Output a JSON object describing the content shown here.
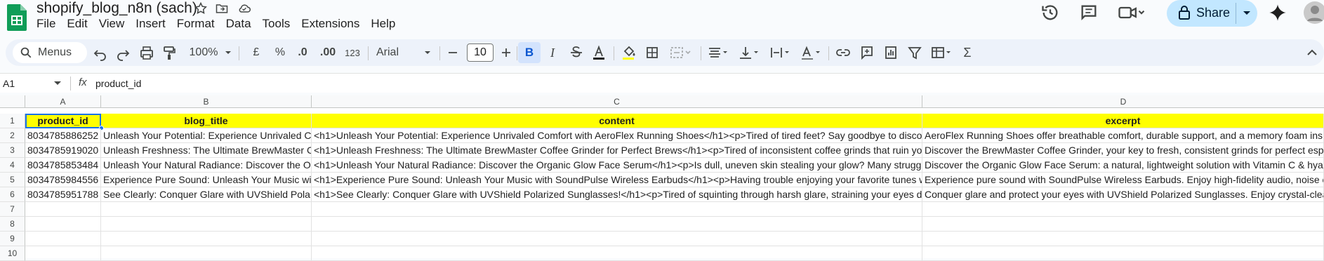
{
  "app": {
    "doc_title": "shopify_blog_n8n (sach)",
    "menu": [
      "File",
      "Edit",
      "View",
      "Insert",
      "Format",
      "Data",
      "Tools",
      "Extensions",
      "Help"
    ],
    "share_label": "Share"
  },
  "toolbar": {
    "menus_label": "Menus",
    "zoom": "100%",
    "currency": "£",
    "percent": "%",
    "dec_decrease": ".0",
    "dec_increase": ".00",
    "number_format": "123",
    "font": "Arial",
    "font_size": "10"
  },
  "formula_bar": {
    "cell_ref": "A1",
    "fx": "fx",
    "value": "product_id"
  },
  "sheet": {
    "columns": [
      "A",
      "B",
      "C",
      "D"
    ],
    "rows": [
      "1",
      "2",
      "3",
      "4",
      "5",
      "6",
      "7",
      "8",
      "9",
      "10"
    ],
    "header": [
      "product_id",
      "blog_title",
      "content",
      "excerpt"
    ],
    "data": [
      [
        "8034785886252",
        "Unleash Your Potential: Experience Unrivaled C",
        "<h1>Unleash Your Potential: Experience Unrivaled Comfort with AeroFlex Running Shoes</h1><p>Tired of tired feet? Say goodbye to disco",
        "AeroFlex Running Shoes offer breathable comfort, durable support, and a memory foam ins"
      ],
      [
        "8034785919020",
        "Unleash Freshness: The Ultimate BrewMaster C",
        "<h1>Unleash Freshness: The Ultimate BrewMaster Coffee Grinder for Perfect Brews</h1><p>Tired of inconsistent coffee grinds that ruin you",
        "Discover the BrewMaster Coffee Grinder, your key to fresh, consistent grinds for perfect esp"
      ],
      [
        "8034785853484",
        "Unleash Your Natural Radiance: Discover the O",
        "<h1>Unleash Your Natural Radiance: Discover the Organic Glow Face Serum</h1><p>Is dull, uneven skin stealing your glow? Many struggl",
        "Discover the Organic Glow Face Serum: a natural, lightweight solution with Vitamin C & hyal"
      ],
      [
        "8034785984556",
        "Experience Pure Sound: Unleash Your Music wi",
        "<h1>Experience Pure Sound: Unleash Your Music with SoundPulse Wireless Earbuds</h1><p>Having trouble enjoying your favorite tunes w",
        "Experience pure sound with SoundPulse Wireless Earbuds. Enjoy high-fidelity audio, noise c"
      ],
      [
        "8034785951788",
        "See Clearly: Conquer Glare with UVShield Pola",
        "<h1>See Clearly: Conquer Glare with UVShield Polarized Sunglasses!</h1><p>Tired of squinting through harsh glare, straining your eyes du",
        "Conquer glare and protect your eyes with UVShield Polarized Sunglasses. Enjoy crystal-clea"
      ]
    ]
  },
  "colors": {
    "header_fill": "#ffff00",
    "selection": "#1a73e8",
    "share_bg": "#c2e7ff"
  }
}
